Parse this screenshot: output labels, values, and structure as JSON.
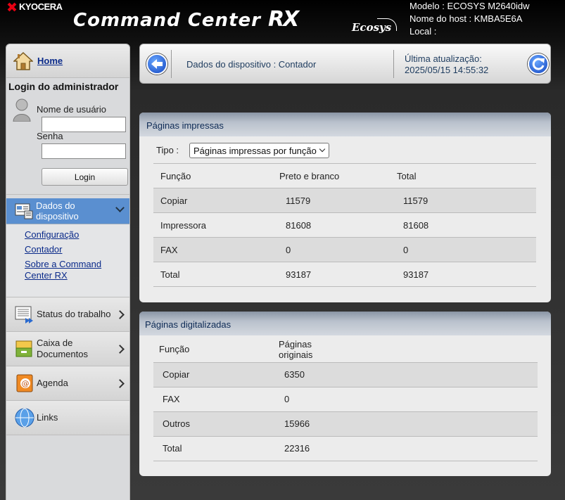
{
  "header": {
    "brand": "KYOCERA",
    "product_name": "Command Center",
    "product_suffix": "RX",
    "ecosys": "Ecosys",
    "model": "Modelo : ECOSYS M2640idw",
    "host": "Nome do host : KMBA5E6A",
    "location": "Local :"
  },
  "sidebar": {
    "home": "Home",
    "login_title": "Login do administrador",
    "username_label": "Nome de usuário",
    "username_value": "",
    "password_label": "Senha",
    "password_value": "",
    "login_button": "Login",
    "device_info": "Dados do dispositivo",
    "sub_items": [
      "Configuração",
      "Contador",
      "Sobre a Command Center RX"
    ],
    "items": [
      "Status do trabalho",
      "Caixa de Documentos",
      "Agenda",
      "Links"
    ]
  },
  "topbar": {
    "breadcrumb": "Dados do dispositivo : Contador",
    "last_update_label": "Última atualização:",
    "last_update_value": "2025/05/15 14:55:32"
  },
  "printed": {
    "title": "Páginas impressas",
    "type_label": "Tipo :",
    "type_value": "Páginas impressas por função",
    "columns": [
      "Função",
      "Preto e branco",
      "Total"
    ],
    "rows": [
      [
        "Copiar",
        "11579",
        "11579"
      ],
      [
        "Impressora",
        "81608",
        "81608"
      ],
      [
        "FAX",
        "0",
        "0"
      ],
      [
        "Total",
        "93187",
        "93187"
      ]
    ]
  },
  "scanned": {
    "title": "Páginas digitalizadas",
    "columns": [
      "Função",
      "Páginas originais"
    ],
    "rows": [
      [
        "Copiar",
        "6350"
      ],
      [
        "FAX",
        "0"
      ],
      [
        "Outros",
        "15966"
      ],
      [
        "Total",
        "22316"
      ]
    ]
  },
  "colors": {
    "accent": "#5a8fd0",
    "link": "#0a2a8a",
    "panel_header_text": "#0d2a55"
  }
}
